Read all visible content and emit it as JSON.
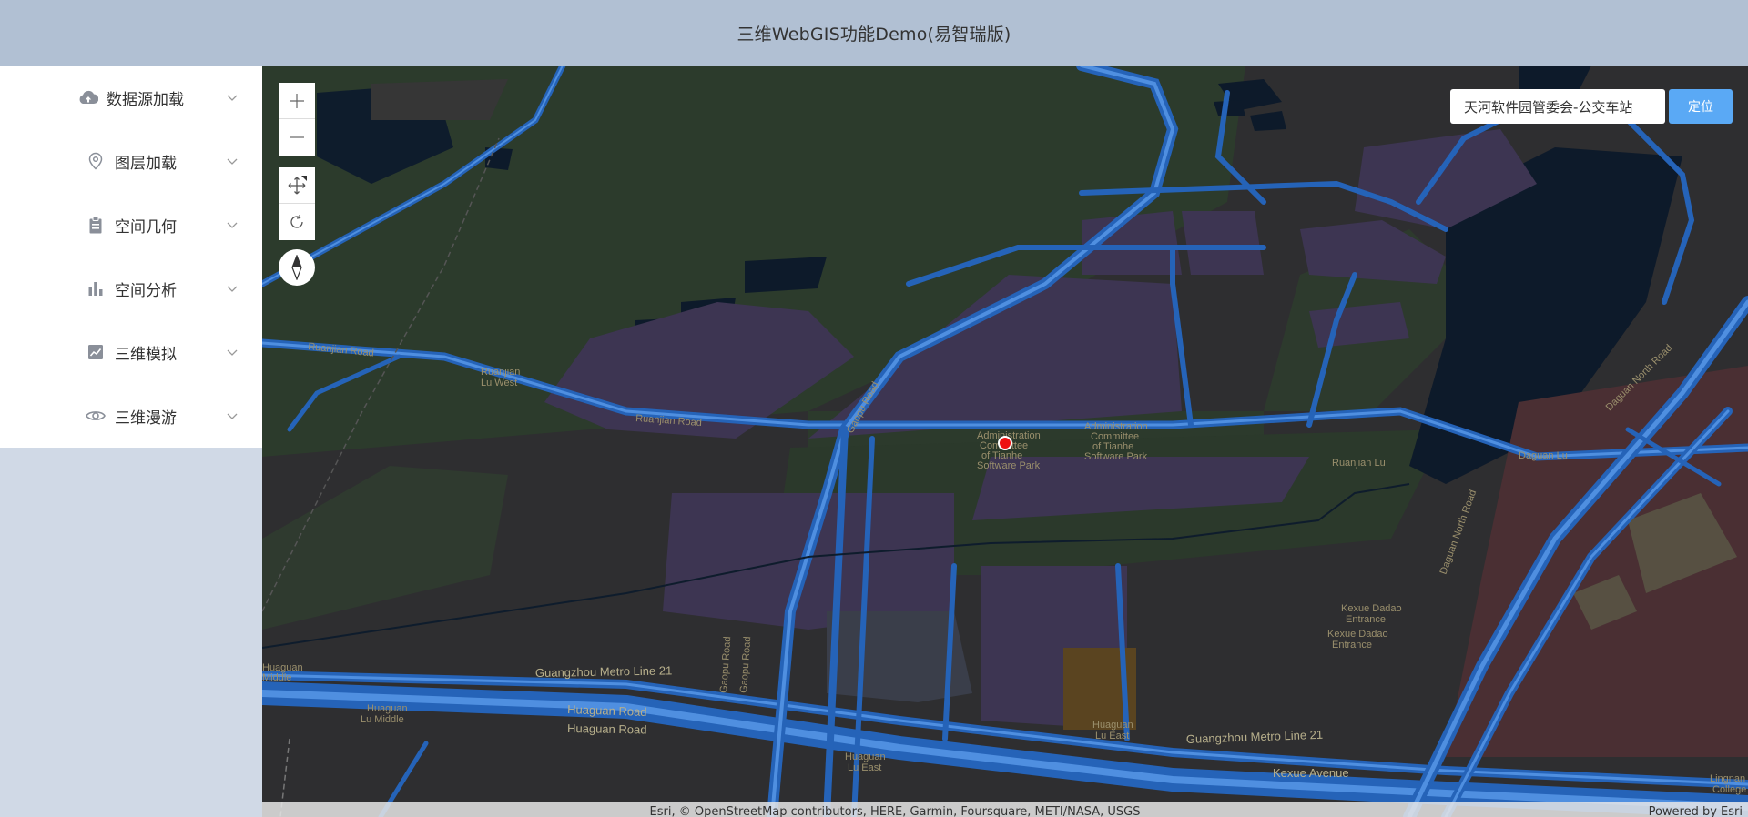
{
  "header": {
    "title": "三维WebGIS功能Demo(易智瑞版)"
  },
  "sidebar": {
    "items": [
      {
        "label": "数据源加载",
        "icon": "cloud-upload-icon"
      },
      {
        "label": "图层加载",
        "icon": "location-pin-icon"
      },
      {
        "label": "空间几何",
        "icon": "clipboard-icon"
      },
      {
        "label": "空间分析",
        "icon": "bar-chart-icon"
      },
      {
        "label": "三维模拟",
        "icon": "line-chart-icon"
      },
      {
        "label": "三维漫游",
        "icon": "eye-icon"
      }
    ]
  },
  "map": {
    "search_value": "天河软件园管委会-公交车站",
    "locate_label": "定位",
    "attribution": "Esri, © OpenStreetMap contributors, HERE, Garmin, Foursquare, METI/NASA, USGS",
    "powered_by": "Powered by Esri",
    "labels": {
      "ruanjian_road": "Ruanjian Road",
      "ruanjian_road_2": "Ruanjian Road",
      "ruanjian_lu_west_1": "Ruanjian",
      "ruanjian_lu_west_2": "Lu West",
      "ruanjian_lu": "Ruanjian Lu",
      "gaopu_road_1": "Gaopu Road",
      "gaopu_road_2": "Gaopu Road",
      "gaopu_road_3": "Gaopu Road",
      "guangzhou_metro_21": "Guangzhou Metro Line 21",
      "guangzhou_metro_21b": "Guangzhou Metro Line 21",
      "huaguan_road_1": "Huaguan Road",
      "huaguan_road_2": "Huaguan Road",
      "huaguan_lu_middle_1": "Huaguan",
      "huaguan_lu_middle_2": "Lu Middle",
      "huaguan_lu_east_1": "Huaguan",
      "huaguan_lu_east_2": "Lu East",
      "huaguan_lu_east_3": "Huaguan",
      "huaguan_lu_east_4": "Lu East",
      "kexue_avenue": "Kexue Avenue",
      "kexue_dadao_1": "Kexue Dadao",
      "kexue_dadao_2": "Entrance",
      "kexue_dadao_3": "Kexue Dadao",
      "kexue_dadao_4": "Entrance",
      "admin_1": "Administration",
      "admin_2": "Committee",
      "admin_3": "of Tianhe",
      "admin_4": "Software Park",
      "admin_b1": "Administration",
      "admin_b2": "Committee",
      "admin_b3": "of Tianhe",
      "admin_b4": "Software Park",
      "daguan_north_1": "Daguan North Road",
      "daguan_north_2": "Daguan North Road",
      "daguan_lu": "Daguan Lu",
      "lingnan_college_1": "Lingnan",
      "lingnan_college_2": "College",
      "huaguan_middle_top_1": "Huaguan",
      "huaguan_middle_top_2": "Middle"
    }
  }
}
